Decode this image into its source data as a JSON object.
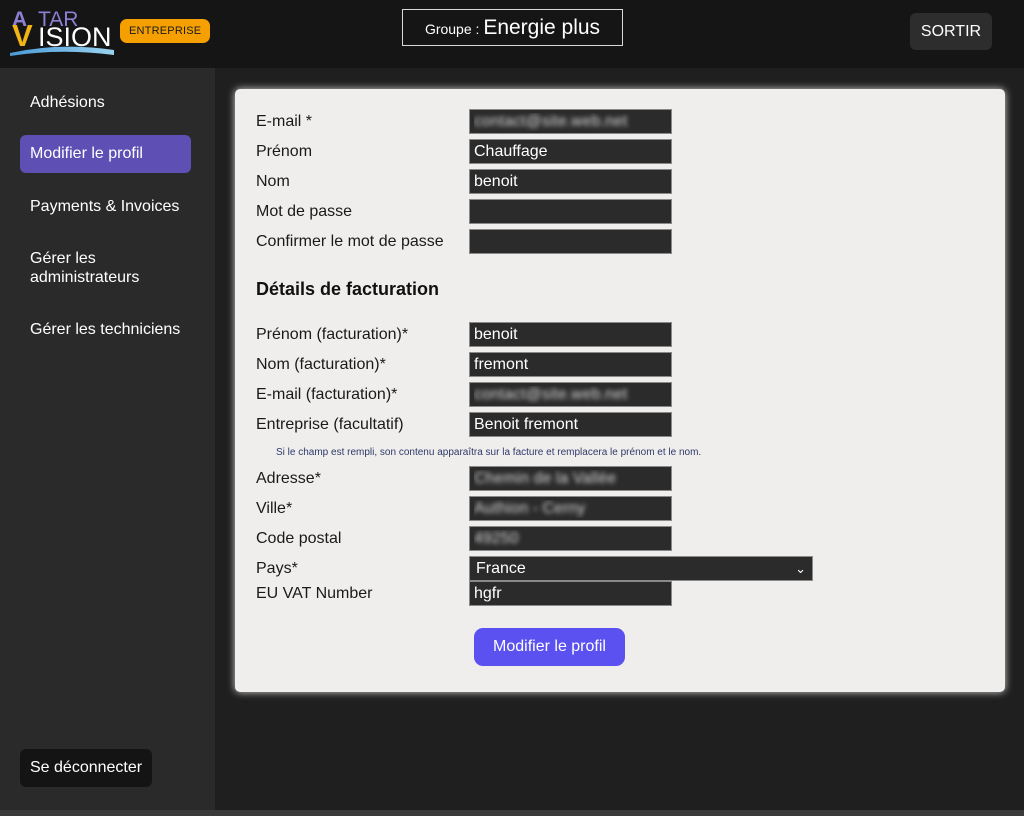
{
  "header": {
    "logo_text_top": "A TAR",
    "logo_text_bottom": "VISION",
    "badge": "ENTREPRISE",
    "group_label": "Groupe : ",
    "group_value": "Energie plus",
    "exit_label": "SORTIR"
  },
  "sidebar": {
    "items": [
      {
        "label": "Adhésions"
      },
      {
        "label": "Modifier le profil"
      },
      {
        "label": "Payments & Invoices"
      },
      {
        "label": "Gérer les administrateurs"
      },
      {
        "label": "Gérer les techniciens"
      }
    ],
    "active_index": 1,
    "logout_label": "Se déconnecter"
  },
  "form": {
    "email_label": "E-mail *",
    "email_value": "contact@site.web.net",
    "firstname_label": "Prénom",
    "firstname_value": "Chauffage",
    "lastname_label": "Nom",
    "lastname_value": "benoit",
    "password_label": "Mot de passe",
    "password_value": "",
    "confirm_label": "Confirmer le mot de passe",
    "confirm_value": "",
    "billing_title": "Détails de facturation",
    "billing_firstname_label": "Prénom (facturation)*",
    "billing_firstname_value": "benoit",
    "billing_lastname_label": "Nom (facturation)*",
    "billing_lastname_value": "fremont",
    "billing_email_label": "E-mail (facturation)*",
    "billing_email_value": "contact@site.web.net",
    "company_label": "Entreprise (facultatif)",
    "company_value": "Benoit fremont",
    "company_hint": "Si le champ est rempli, son contenu apparaîtra sur la facture et remplacera le prénom et le nom.",
    "address_label": "Adresse*",
    "address_value": "Chemin de la Vallée",
    "city_label": "Ville*",
    "city_value": "Authion - Cerny",
    "postal_label": "Code postal",
    "postal_value": "49250",
    "country_label": "Pays*",
    "country_value": "France",
    "vat_label": "EU VAT Number",
    "vat_value": "hgfr",
    "submit_label": "Modifier le profil"
  },
  "colors": {
    "accent_purple": "#5e4fb5",
    "submit_blue": "#5b50f0",
    "badge_orange": "#f5a000"
  }
}
